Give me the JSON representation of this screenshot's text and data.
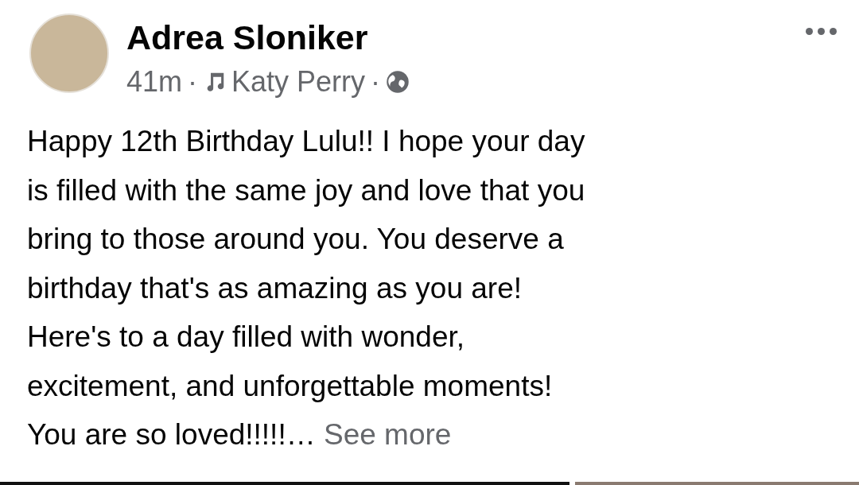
{
  "post": {
    "author": "Adrea Sloniker",
    "time": "41m",
    "separator": "·",
    "music": "Katy Perry",
    "text": "Happy 12th Birthday Lulu!!  I hope your day\nis filled with the same joy and love that you\nbring to those around you. You deserve a\nbirthday that's as amazing as you are!\nHere's to a day filled with wonder,\nexcitement, and unforgettable moments!\nYou are so loved!!!!!…",
    "see_more": "See more"
  }
}
